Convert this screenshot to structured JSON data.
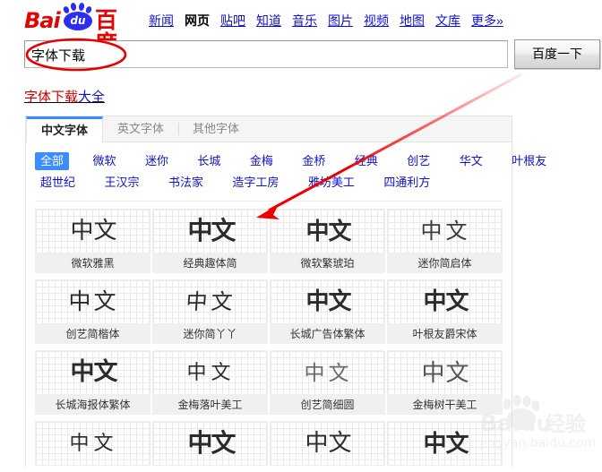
{
  "brand": {
    "logo_bai": "Bai",
    "logo_du": "du",
    "logo_cn": "百度",
    "paw_icon": "paw-icon"
  },
  "nav": {
    "items": [
      {
        "label": "新闻",
        "active": false
      },
      {
        "label": "网页",
        "active": true
      },
      {
        "label": "贴吧",
        "active": false
      },
      {
        "label": "知道",
        "active": false
      },
      {
        "label": "音乐",
        "active": false
      },
      {
        "label": "图片",
        "active": false
      },
      {
        "label": "视频",
        "active": false
      },
      {
        "label": "地图",
        "active": false
      },
      {
        "label": "文库",
        "active": false
      },
      {
        "label": "更多»",
        "active": false
      }
    ]
  },
  "search": {
    "value": "字体下载",
    "placeholder": "",
    "button_label": "百度一下"
  },
  "result_title": {
    "highlight": "字体下载",
    "rest": "大全"
  },
  "tabs": [
    {
      "label": "中文字体",
      "active": true
    },
    {
      "label": "英文字体",
      "active": false
    },
    {
      "label": "其他字体",
      "active": false
    }
  ],
  "filters": {
    "row1": [
      {
        "label": "全部",
        "selected": true
      },
      {
        "label": "微软",
        "selected": false
      },
      {
        "label": "迷你",
        "selected": false
      },
      {
        "label": "长城",
        "selected": false
      },
      {
        "label": "金梅",
        "selected": false
      },
      {
        "label": "金桥",
        "selected": false
      },
      {
        "label": "经典",
        "selected": false
      },
      {
        "label": "创艺",
        "selected": false
      },
      {
        "label": "华文",
        "selected": false
      },
      {
        "label": "叶根友",
        "selected": false
      }
    ],
    "row2": [
      {
        "label": "超世纪",
        "selected": false
      },
      {
        "label": "王汉宗",
        "selected": false
      },
      {
        "label": "书法家",
        "selected": false
      },
      {
        "label": "造字工房",
        "selected": false
      },
      {
        "label": "雅坊美工",
        "selected": false
      },
      {
        "label": "四通利方",
        "selected": false
      }
    ]
  },
  "fonts": {
    "sample_text": "中文",
    "cards": [
      {
        "name": "微软雅黑",
        "style": "v-hei"
      },
      {
        "name": "经典趣体简",
        "style": "v-fat"
      },
      {
        "name": "微软繁琥珀",
        "style": "v-bold"
      },
      {
        "name": "迷你简启体",
        "style": "v-thin"
      },
      {
        "name": "创艺简楷体",
        "style": "v-kai"
      },
      {
        "name": "迷你简丫丫",
        "style": "v-hand"
      },
      {
        "name": "长城广告体繁体",
        "style": "v-song"
      },
      {
        "name": "叶根友爵宋体",
        "style": "v-song"
      },
      {
        "name": "长城海报体繁体",
        "style": "v-poster"
      },
      {
        "name": "金梅落叶美工",
        "style": "v-small"
      },
      {
        "name": "创艺简细圆",
        "style": "v-light"
      },
      {
        "name": "金梅树干美工",
        "style": "v-round"
      },
      {
        "name": "",
        "style": "v-small"
      },
      {
        "name": "",
        "style": "v-fat"
      },
      {
        "name": "",
        "style": "v-hei"
      },
      {
        "name": "",
        "style": "v-bold"
      }
    ]
  },
  "annotations": {
    "ellipse_color": "#e60000",
    "arrow_color": "#ef0000",
    "ellipse_target": "字体下载",
    "arrow_target": "经典趣体简"
  },
  "watermark": {
    "brand": "Baidu",
    "label": "经验",
    "url": "jingyan.baidu.com"
  }
}
